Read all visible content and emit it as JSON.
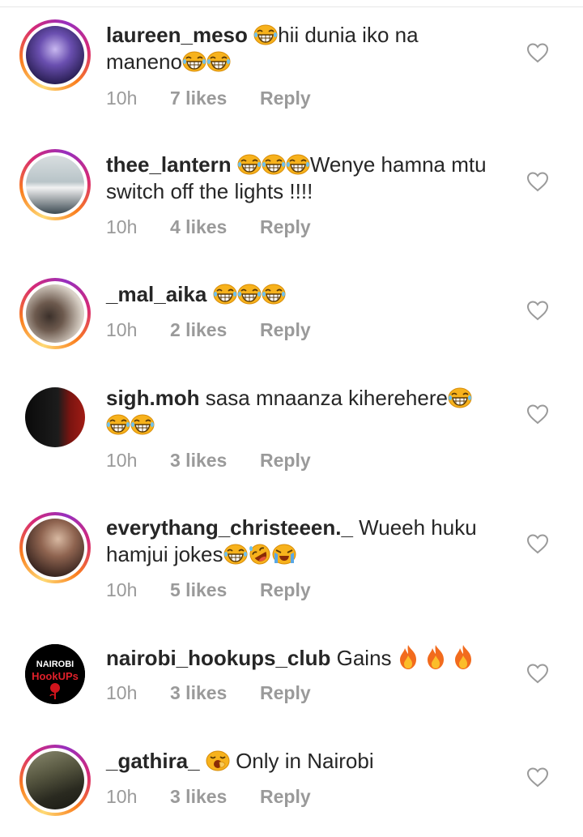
{
  "comments": [
    {
      "username": "laureen_meso",
      "text_line1": "hii dunia iko na",
      "text_line2": "maneno",
      "time": "10h",
      "likes": "7 likes",
      "reply": "Reply",
      "avatar_colors": [
        "#4b3a8c",
        "#2a1f55"
      ]
    },
    {
      "username": "thee_lantern",
      "text_line1": "Wenye hamna mtu",
      "text_line2": "switch off the lights !!!!",
      "time": "10h",
      "likes": "4 likes",
      "reply": "Reply",
      "avatar_colors": [
        "#cfd6d8",
        "#5f7a85"
      ]
    },
    {
      "username": "_mal_aika",
      "text_line1": "",
      "time": "10h",
      "likes": "2 likes",
      "reply": "Reply",
      "avatar_colors": [
        "#e8e3dc",
        "#3b302a"
      ]
    },
    {
      "username": "sigh.moh",
      "text_line1": "sasa mnaanza kiherehere",
      "time": "10h",
      "likes": "3 likes",
      "reply": "Reply",
      "avatar_colors": [
        "#1a1a1a",
        "#8a1a12"
      ]
    },
    {
      "username": "everythang_christeeen._",
      "text_line1": "Wueeh huku",
      "text_line2": "hamjui jokes",
      "time": "10h",
      "likes": "5 likes",
      "reply": "Reply",
      "avatar_colors": [
        "#5a3d33",
        "#c9a48a"
      ]
    },
    {
      "username": "nairobi_hookups_club",
      "text_line1": "Gains",
      "time": "10h",
      "likes": "3 likes",
      "reply": "Reply",
      "logo_text_top": "NAIROBI",
      "logo_text_bottom": "HookUPs",
      "avatar_colors": [
        "#000000",
        "#e0202a"
      ]
    },
    {
      "username": "_gathira_",
      "text_line1": "Only in Nairobi",
      "time": "10h",
      "likes": "3 likes",
      "reply": "Reply",
      "avatar_colors": [
        "#6b6b55",
        "#1f1f1a"
      ]
    }
  ],
  "colors": {
    "text": "#262626",
    "meta": "#9a9a9a",
    "emoji_yellow": "#f7b21c",
    "fire_orange": "#f26b1d"
  },
  "icons": {
    "like": "heart-outline-icon",
    "laugh": "face-with-tears-of-joy-icon",
    "rofl": "rolling-on-the-floor-laughing-icon",
    "crying": "loudly-crying-face-icon",
    "yawn": "yawning-face-icon",
    "fire": "fire-icon"
  }
}
